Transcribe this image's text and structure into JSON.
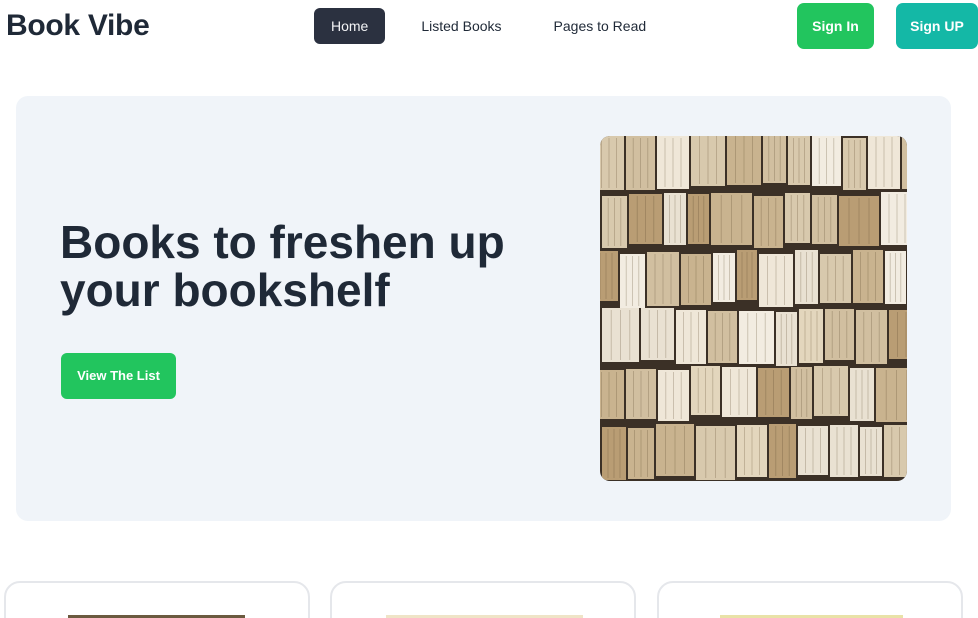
{
  "navbar": {
    "brand": "Book Vibe",
    "links": [
      {
        "label": "Home",
        "active": true
      },
      {
        "label": "Listed Books",
        "active": false
      },
      {
        "label": "Pages to Read",
        "active": false
      }
    ],
    "sign_in": "Sign In",
    "sign_up": "Sign UP"
  },
  "hero": {
    "title": "Books to freshen up your bookshelf",
    "cta": "View The List",
    "image": "open-books-wall-photo"
  },
  "colors": {
    "primary_green": "#22c55e",
    "teal": "#14b8a6",
    "dark": "#1f2937",
    "active_nav": "#2b3140",
    "hero_bg": "#f0f4f9"
  },
  "book_cards": [
    {
      "thumb": "book-cover-1"
    },
    {
      "thumb": "book-cover-2"
    },
    {
      "thumb": "book-cover-3"
    }
  ]
}
